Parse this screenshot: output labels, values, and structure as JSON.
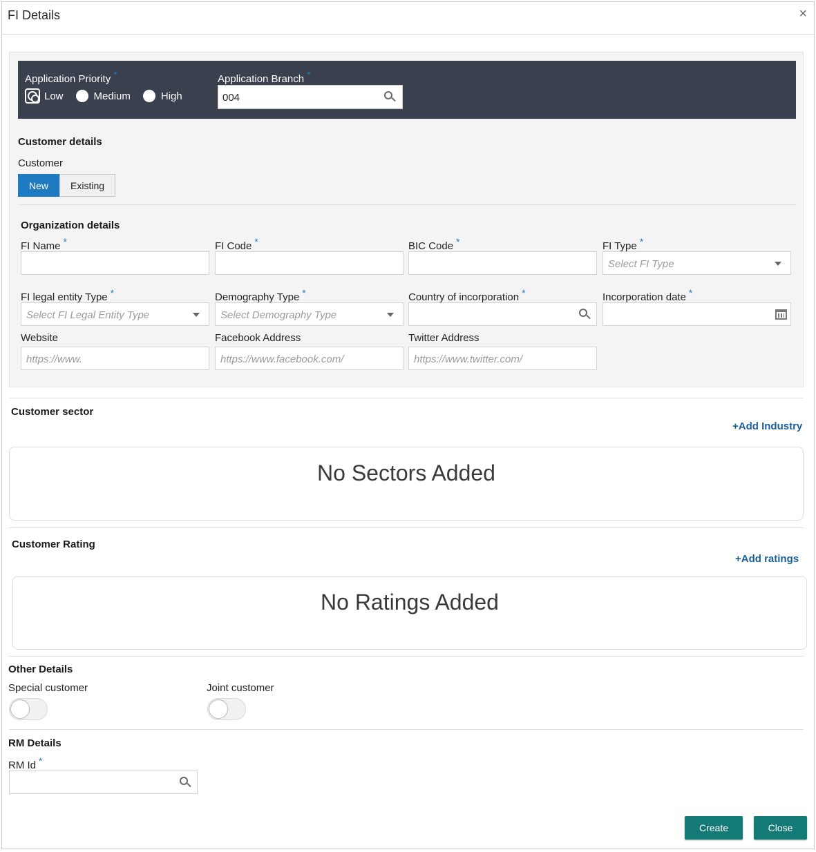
{
  "window": {
    "title": "FI Details",
    "close_glyph": "×"
  },
  "application": {
    "priority_label": "Application Priority",
    "priority_options": [
      "Low",
      "Medium",
      "High"
    ],
    "priority_selected": "Low",
    "branch_label": "Application Branch",
    "branch_value": "004",
    "required_mark": "*"
  },
  "customer_details": {
    "heading": "Customer details",
    "customer_label": "Customer",
    "toggle_new": "New",
    "toggle_existing": "Existing"
  },
  "organization": {
    "heading": "Organization details",
    "fi_name_label": "FI Name",
    "fi_code_label": "FI Code",
    "bic_code_label": "BIC Code",
    "fi_type_label": "FI Type",
    "fi_type_placeholder": "Select FI Type",
    "legal_entity_label": "FI legal entity Type",
    "legal_entity_placeholder": "Select FI Legal Entity Type",
    "demography_label": "Demography Type",
    "demography_placeholder": "Select Demography Type",
    "country_label": "Country of incorporation",
    "incorp_date_label": "Incorporation date",
    "website_label": "Website",
    "website_placeholder": "https://www.",
    "facebook_label": "Facebook Address",
    "facebook_placeholder": "https://www.facebook.com/",
    "twitter_label": "Twitter Address",
    "twitter_placeholder": "https://www.twitter.com/"
  },
  "sector": {
    "heading": "Customer sector",
    "add_link": "+Add Industry",
    "empty_text": "No Sectors Added"
  },
  "rating": {
    "heading": "Customer Rating",
    "add_link": "+Add ratings",
    "empty_text": "No Ratings Added"
  },
  "other": {
    "heading": "Other Details",
    "special_label": "Special customer",
    "joint_label": "Joint customer"
  },
  "rm": {
    "heading": "RM Details",
    "rm_id_label": "RM Id"
  },
  "footer": {
    "create_label": "Create",
    "close_label": "Close"
  },
  "colors": {
    "accent": "#1f7bc1",
    "band": "#3a404d",
    "button": "#137a75",
    "link": "#1a5f9c"
  }
}
